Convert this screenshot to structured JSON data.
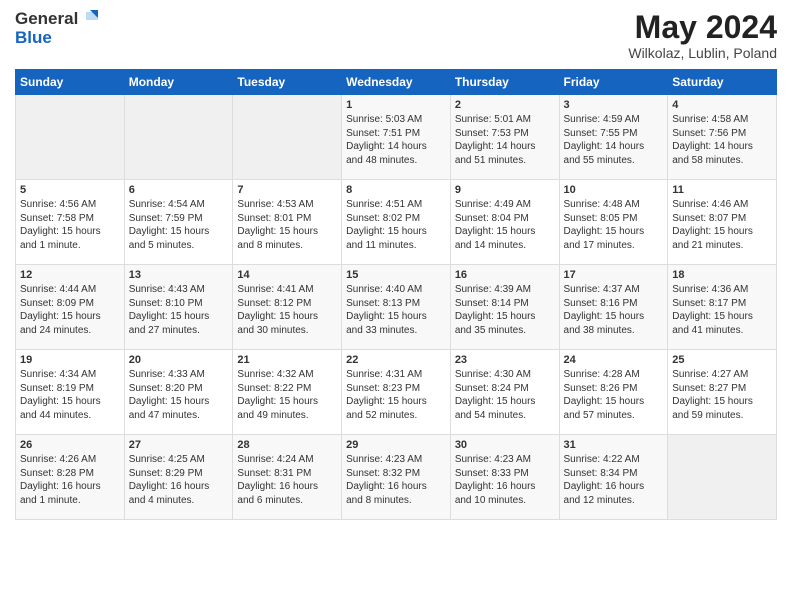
{
  "header": {
    "logo_general": "General",
    "logo_blue": "Blue",
    "title": "May 2024",
    "subtitle": "Wilkolaz, Lublin, Poland"
  },
  "columns": [
    "Sunday",
    "Monday",
    "Tuesday",
    "Wednesday",
    "Thursday",
    "Friday",
    "Saturday"
  ],
  "weeks": [
    [
      {
        "day": "",
        "sunrise": "",
        "sunset": "",
        "daylight": ""
      },
      {
        "day": "",
        "sunrise": "",
        "sunset": "",
        "daylight": ""
      },
      {
        "day": "",
        "sunrise": "",
        "sunset": "",
        "daylight": ""
      },
      {
        "day": "1",
        "sunrise": "Sunrise: 5:03 AM",
        "sunset": "Sunset: 7:51 PM",
        "daylight": "Daylight: 14 hours and 48 minutes."
      },
      {
        "day": "2",
        "sunrise": "Sunrise: 5:01 AM",
        "sunset": "Sunset: 7:53 PM",
        "daylight": "Daylight: 14 hours and 51 minutes."
      },
      {
        "day": "3",
        "sunrise": "Sunrise: 4:59 AM",
        "sunset": "Sunset: 7:55 PM",
        "daylight": "Daylight: 14 hours and 55 minutes."
      },
      {
        "day": "4",
        "sunrise": "Sunrise: 4:58 AM",
        "sunset": "Sunset: 7:56 PM",
        "daylight": "Daylight: 14 hours and 58 minutes."
      }
    ],
    [
      {
        "day": "5",
        "sunrise": "Sunrise: 4:56 AM",
        "sunset": "Sunset: 7:58 PM",
        "daylight": "Daylight: 15 hours and 1 minute."
      },
      {
        "day": "6",
        "sunrise": "Sunrise: 4:54 AM",
        "sunset": "Sunset: 7:59 PM",
        "daylight": "Daylight: 15 hours and 5 minutes."
      },
      {
        "day": "7",
        "sunrise": "Sunrise: 4:53 AM",
        "sunset": "Sunset: 8:01 PM",
        "daylight": "Daylight: 15 hours and 8 minutes."
      },
      {
        "day": "8",
        "sunrise": "Sunrise: 4:51 AM",
        "sunset": "Sunset: 8:02 PM",
        "daylight": "Daylight: 15 hours and 11 minutes."
      },
      {
        "day": "9",
        "sunrise": "Sunrise: 4:49 AM",
        "sunset": "Sunset: 8:04 PM",
        "daylight": "Daylight: 15 hours and 14 minutes."
      },
      {
        "day": "10",
        "sunrise": "Sunrise: 4:48 AM",
        "sunset": "Sunset: 8:05 PM",
        "daylight": "Daylight: 15 hours and 17 minutes."
      },
      {
        "day": "11",
        "sunrise": "Sunrise: 4:46 AM",
        "sunset": "Sunset: 8:07 PM",
        "daylight": "Daylight: 15 hours and 21 minutes."
      }
    ],
    [
      {
        "day": "12",
        "sunrise": "Sunrise: 4:44 AM",
        "sunset": "Sunset: 8:09 PM",
        "daylight": "Daylight: 15 hours and 24 minutes."
      },
      {
        "day": "13",
        "sunrise": "Sunrise: 4:43 AM",
        "sunset": "Sunset: 8:10 PM",
        "daylight": "Daylight: 15 hours and 27 minutes."
      },
      {
        "day": "14",
        "sunrise": "Sunrise: 4:41 AM",
        "sunset": "Sunset: 8:12 PM",
        "daylight": "Daylight: 15 hours and 30 minutes."
      },
      {
        "day": "15",
        "sunrise": "Sunrise: 4:40 AM",
        "sunset": "Sunset: 8:13 PM",
        "daylight": "Daylight: 15 hours and 33 minutes."
      },
      {
        "day": "16",
        "sunrise": "Sunrise: 4:39 AM",
        "sunset": "Sunset: 8:14 PM",
        "daylight": "Daylight: 15 hours and 35 minutes."
      },
      {
        "day": "17",
        "sunrise": "Sunrise: 4:37 AM",
        "sunset": "Sunset: 8:16 PM",
        "daylight": "Daylight: 15 hours and 38 minutes."
      },
      {
        "day": "18",
        "sunrise": "Sunrise: 4:36 AM",
        "sunset": "Sunset: 8:17 PM",
        "daylight": "Daylight: 15 hours and 41 minutes."
      }
    ],
    [
      {
        "day": "19",
        "sunrise": "Sunrise: 4:34 AM",
        "sunset": "Sunset: 8:19 PM",
        "daylight": "Daylight: 15 hours and 44 minutes."
      },
      {
        "day": "20",
        "sunrise": "Sunrise: 4:33 AM",
        "sunset": "Sunset: 8:20 PM",
        "daylight": "Daylight: 15 hours and 47 minutes."
      },
      {
        "day": "21",
        "sunrise": "Sunrise: 4:32 AM",
        "sunset": "Sunset: 8:22 PM",
        "daylight": "Daylight: 15 hours and 49 minutes."
      },
      {
        "day": "22",
        "sunrise": "Sunrise: 4:31 AM",
        "sunset": "Sunset: 8:23 PM",
        "daylight": "Daylight: 15 hours and 52 minutes."
      },
      {
        "day": "23",
        "sunrise": "Sunrise: 4:30 AM",
        "sunset": "Sunset: 8:24 PM",
        "daylight": "Daylight: 15 hours and 54 minutes."
      },
      {
        "day": "24",
        "sunrise": "Sunrise: 4:28 AM",
        "sunset": "Sunset: 8:26 PM",
        "daylight": "Daylight: 15 hours and 57 minutes."
      },
      {
        "day": "25",
        "sunrise": "Sunrise: 4:27 AM",
        "sunset": "Sunset: 8:27 PM",
        "daylight": "Daylight: 15 hours and 59 minutes."
      }
    ],
    [
      {
        "day": "26",
        "sunrise": "Sunrise: 4:26 AM",
        "sunset": "Sunset: 8:28 PM",
        "daylight": "Daylight: 16 hours and 1 minute."
      },
      {
        "day": "27",
        "sunrise": "Sunrise: 4:25 AM",
        "sunset": "Sunset: 8:29 PM",
        "daylight": "Daylight: 16 hours and 4 minutes."
      },
      {
        "day": "28",
        "sunrise": "Sunrise: 4:24 AM",
        "sunset": "Sunset: 8:31 PM",
        "daylight": "Daylight: 16 hours and 6 minutes."
      },
      {
        "day": "29",
        "sunrise": "Sunrise: 4:23 AM",
        "sunset": "Sunset: 8:32 PM",
        "daylight": "Daylight: 16 hours and 8 minutes."
      },
      {
        "day": "30",
        "sunrise": "Sunrise: 4:23 AM",
        "sunset": "Sunset: 8:33 PM",
        "daylight": "Daylight: 16 hours and 10 minutes."
      },
      {
        "day": "31",
        "sunrise": "Sunrise: 4:22 AM",
        "sunset": "Sunset: 8:34 PM",
        "daylight": "Daylight: 16 hours and 12 minutes."
      },
      {
        "day": "",
        "sunrise": "",
        "sunset": "",
        "daylight": ""
      }
    ]
  ]
}
